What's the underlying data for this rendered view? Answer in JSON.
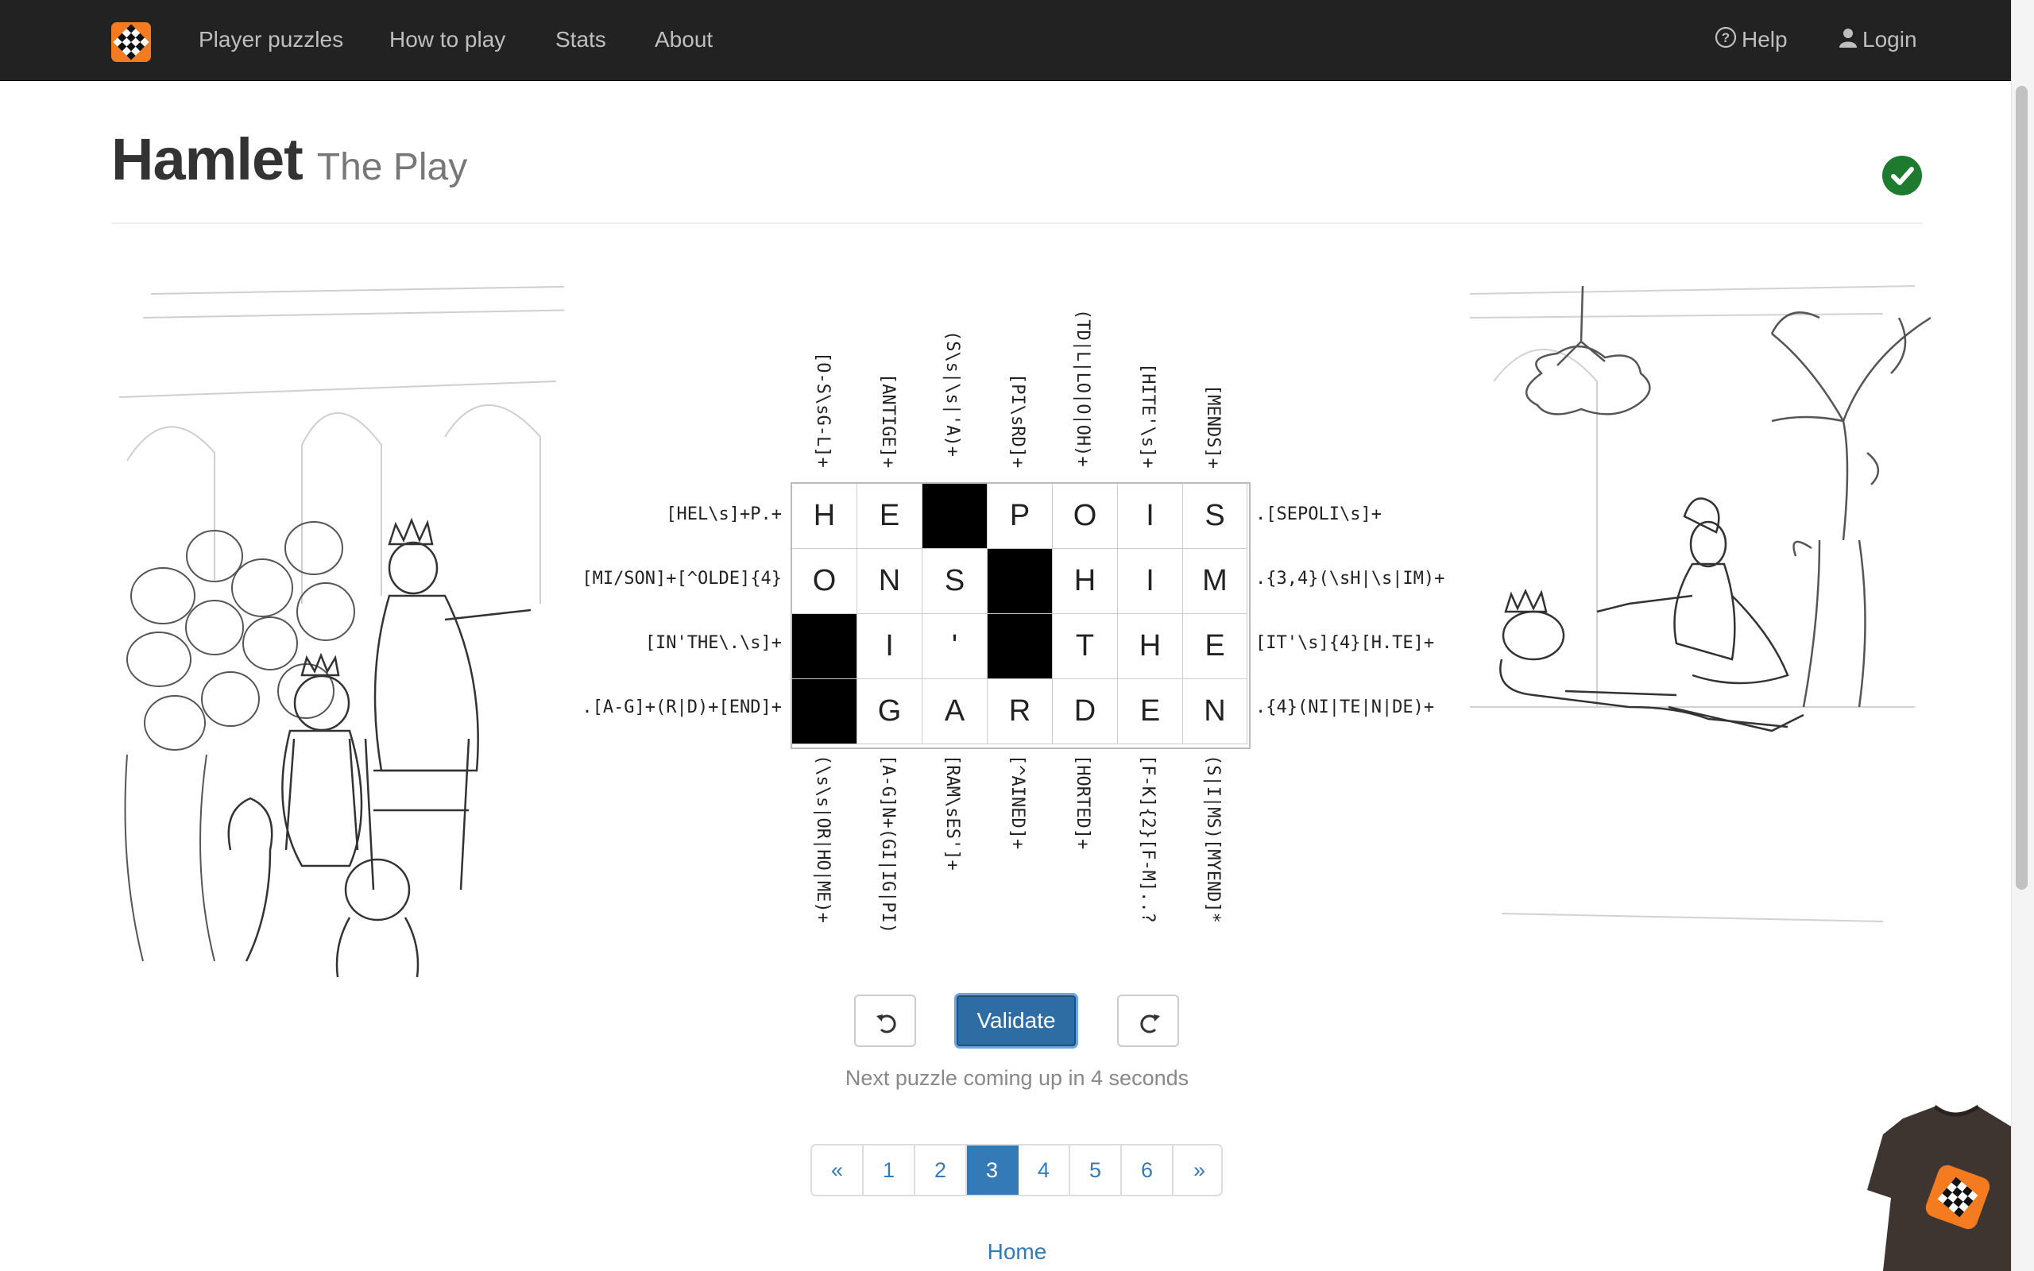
{
  "nav": {
    "items": [
      "Player puzzles",
      "How to play",
      "Stats",
      "About"
    ],
    "help": "Help",
    "login": "Login"
  },
  "header": {
    "title": "Hamlet",
    "subtitle": "The Play"
  },
  "puzzle": {
    "top_clues": [
      "[O-S\\sG-L]+",
      "[ANTIGE]+",
      "(S\\s|\\s|'A)+",
      "[PI\\sRD]+",
      "(TD|L|LO|O|OH)+",
      "[HITE'\\s]+",
      "[MENDS]+"
    ],
    "bottom_clues": [
      "(\\s\\s|OR|HO|ME)+",
      "[A-G]N+(GI|IG|PI)",
      "[RAM\\sES']+",
      "[^AINED]+",
      "[HORTED]+",
      "[F-K]{2}[F-M]..?",
      "(S|I|MS)[MYEND]*"
    ],
    "left_clues": [
      "[HEL\\s]+P.+",
      "[MI/SON]+[^OLDE]{4}",
      "[IN'THE\\.\\s]+",
      ".[A-G]+(R|D)+[END]+"
    ],
    "right_clues": [
      ".[SEPOLI\\s]+",
      ".{3,4}(\\sH|\\s|IM)+",
      "[IT'\\s]{4}[H.TE]+",
      ".{4}(NI|TE|N|DE)+"
    ],
    "rows": [
      [
        "H",
        "E",
        "#",
        "P",
        "O",
        "I",
        "S"
      ],
      [
        "O",
        "N",
        "S",
        "#",
        "H",
        "I",
        "M"
      ],
      [
        "#",
        "I",
        "'",
        "#",
        "T",
        "H",
        "E"
      ],
      [
        "#",
        "G",
        "A",
        "R",
        "D",
        "E",
        "N"
      ]
    ]
  },
  "controls": {
    "validate": "Validate",
    "undo_icon": "undo-icon",
    "redo_icon": "redo-icon",
    "status": "Next puzzle coming up in 4 seconds"
  },
  "pagination": {
    "prev": "«",
    "pages": [
      "1",
      "2",
      "3",
      "4",
      "5",
      "6"
    ],
    "active": "3",
    "next": "»"
  },
  "footer": {
    "home": "Home"
  },
  "colors": {
    "navbar": "#222222",
    "accent": "#337ab7",
    "logo": "#f47b20",
    "solved": "#1e7a2f"
  }
}
